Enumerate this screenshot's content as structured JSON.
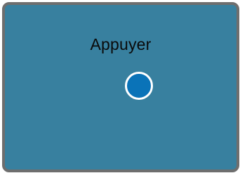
{
  "screen": {
    "title": "Appuyer"
  },
  "colors": {
    "background": "#38809f",
    "border": "#6e6e6e",
    "target_fill": "#0a73b8",
    "target_ring": "#ffffff",
    "text": "#0a0a0a"
  }
}
